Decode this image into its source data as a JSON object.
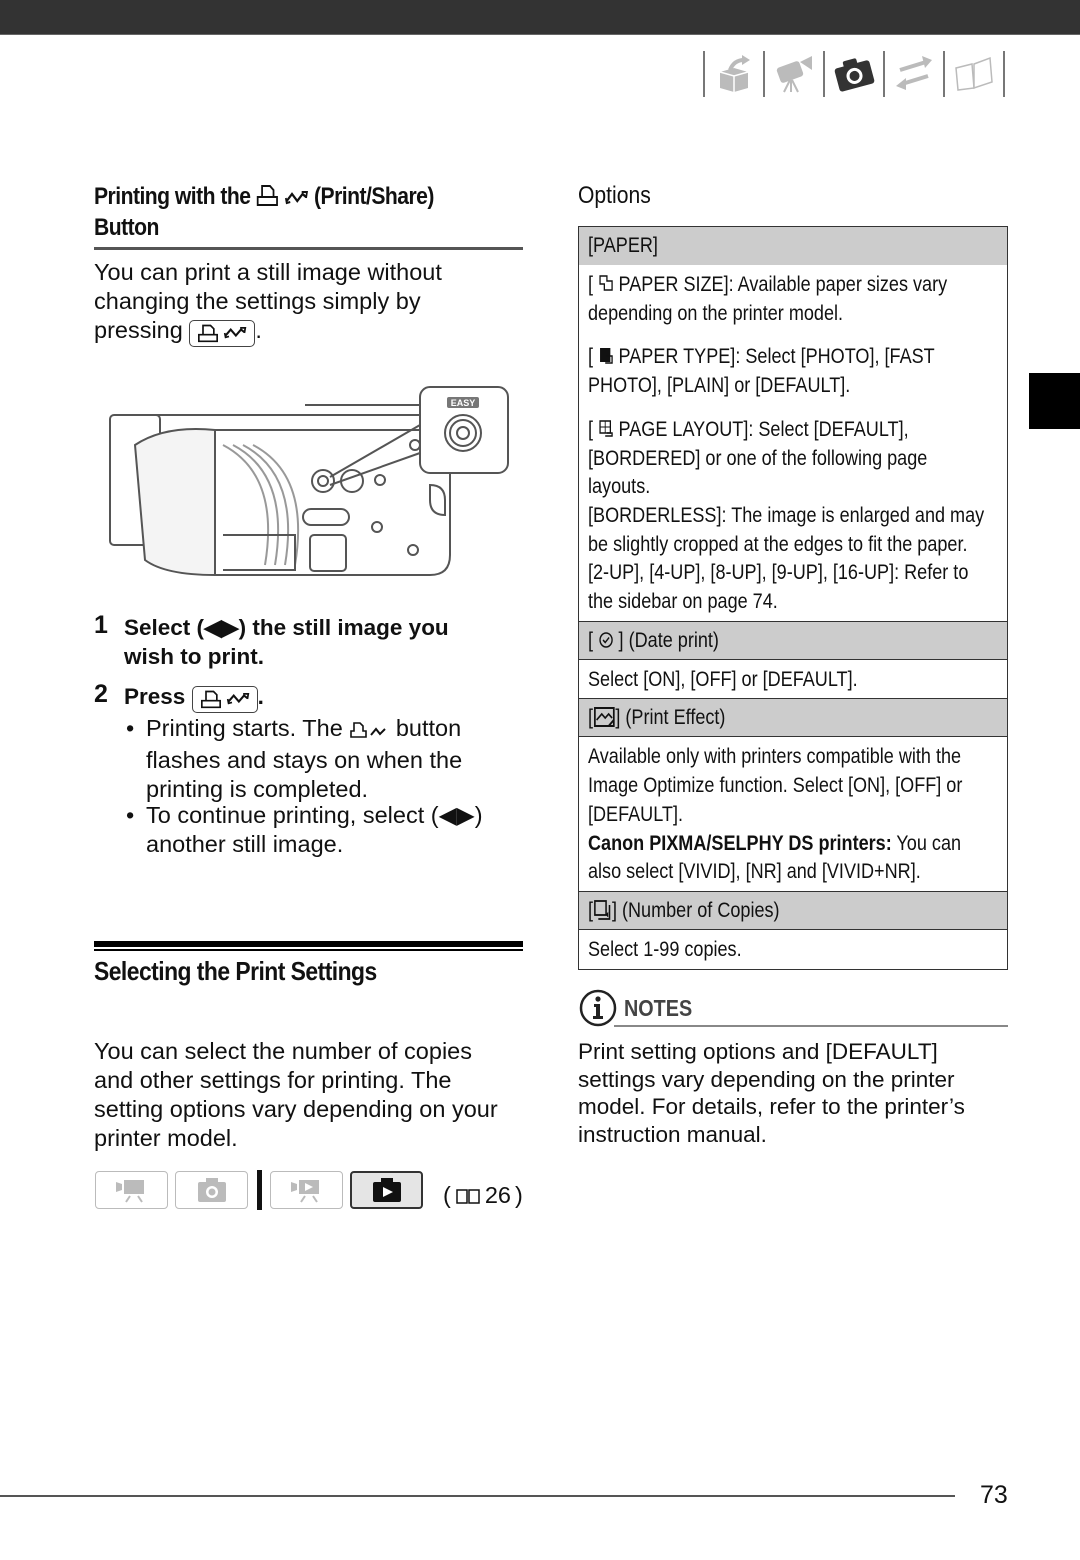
{
  "header": {
    "nav_icons": [
      {
        "name": "introduction-box-icon",
        "active": false
      },
      {
        "name": "movies-camcorder-icon",
        "active": false
      },
      {
        "name": "photos-camera-icon",
        "active": true
      },
      {
        "name": "external-connections-icon",
        "active": false
      },
      {
        "name": "additional-info-book-icon",
        "active": false
      }
    ]
  },
  "left": {
    "print_share_heading_pre": "Printing with the",
    "print_share_heading_post": "(Print/Share)",
    "print_share_heading_line2": "Button",
    "intro_line1": "You can print a still image without",
    "intro_line2": "changing the settings simply by",
    "intro_line3_pre": "pressing",
    "intro_line3_post": ".",
    "camera_label_easy": "EASY",
    "steps": [
      {
        "num": "1",
        "line1": "Select (◀▶) the still image you",
        "line2": "wish to print."
      },
      {
        "num": "2",
        "pre": "Press",
        "post": "."
      }
    ],
    "bullets": [
      {
        "line1_pre": "Printing starts. The",
        "line1_post": "button",
        "line2": "flashes and stays on when the",
        "line3": "printing is completed."
      },
      {
        "line1": "To continue printing, select (◀▶)",
        "line2": "another still image."
      }
    ],
    "settings_heading": "Selecting the Print Settings",
    "settings_text": [
      "You can select the number of copies",
      "and other settings for printing. The",
      "setting options vary depending on your",
      "printer model."
    ],
    "mode_buttons": [
      {
        "name": "movie-record-mode",
        "active": false
      },
      {
        "name": "photo-record-mode",
        "active": false
      },
      {
        "name": "movie-playback-mode",
        "active": false
      },
      {
        "name": "photo-playback-mode",
        "active": true
      }
    ],
    "page_ref": "26"
  },
  "options": {
    "title": "Options",
    "paper_header": "[PAPER]",
    "paper_size": {
      "pre": "[",
      "label": "PAPER SIZE]: Available paper sizes vary",
      "line2": "depending on the printer model."
    },
    "paper_type": {
      "pre": "[",
      "label": "PAPER TYPE]: Select [PHOTO], [FAST",
      "line2": "PHOTO], [PLAIN] or [DEFAULT]."
    },
    "page_layout": {
      "pre": "[",
      "label": "PAGE LAYOUT]: Select [DEFAULT],",
      "line2": "[BORDERED] or one of the following page",
      "line3": "layouts.",
      "line4": "[BORDERLESS]: The image is enlarged and may",
      "line5": "be slightly cropped at the edges to fit the paper.",
      "line6": "[2-UP], [4-UP], [8-UP], [9-UP], [16-UP]: Refer to",
      "line7": "the sidebar on page 74."
    },
    "date_print_header": "] (Date print)",
    "date_print_text": "Select [ON], [OFF] or [DEFAULT].",
    "print_effect_header": "] (Print Effect)",
    "print_effect_line1": "Available only with printers compatible with the",
    "print_effect_line2": "Image Optimize function. Select [ON], [OFF] or",
    "print_effect_line3": "[DEFAULT].",
    "print_effect_bold": "Canon PIXMA/SELPHY DS printers:",
    "print_effect_line4_post": " You can",
    "print_effect_line5": "also select [VIVID], [NR] and [VIVID+NR].",
    "copies_header": "] (Number of Copies)",
    "copies_text": "Select 1-99 copies.",
    "bracket_open": "["
  },
  "notes": {
    "label": "NOTES",
    "lines": [
      "Print setting options and [DEFAULT]",
      "settings vary depending on the printer",
      "model. For details, refer to the printer’s",
      "instruction manual."
    ]
  },
  "footer": {
    "page_number": "73"
  }
}
